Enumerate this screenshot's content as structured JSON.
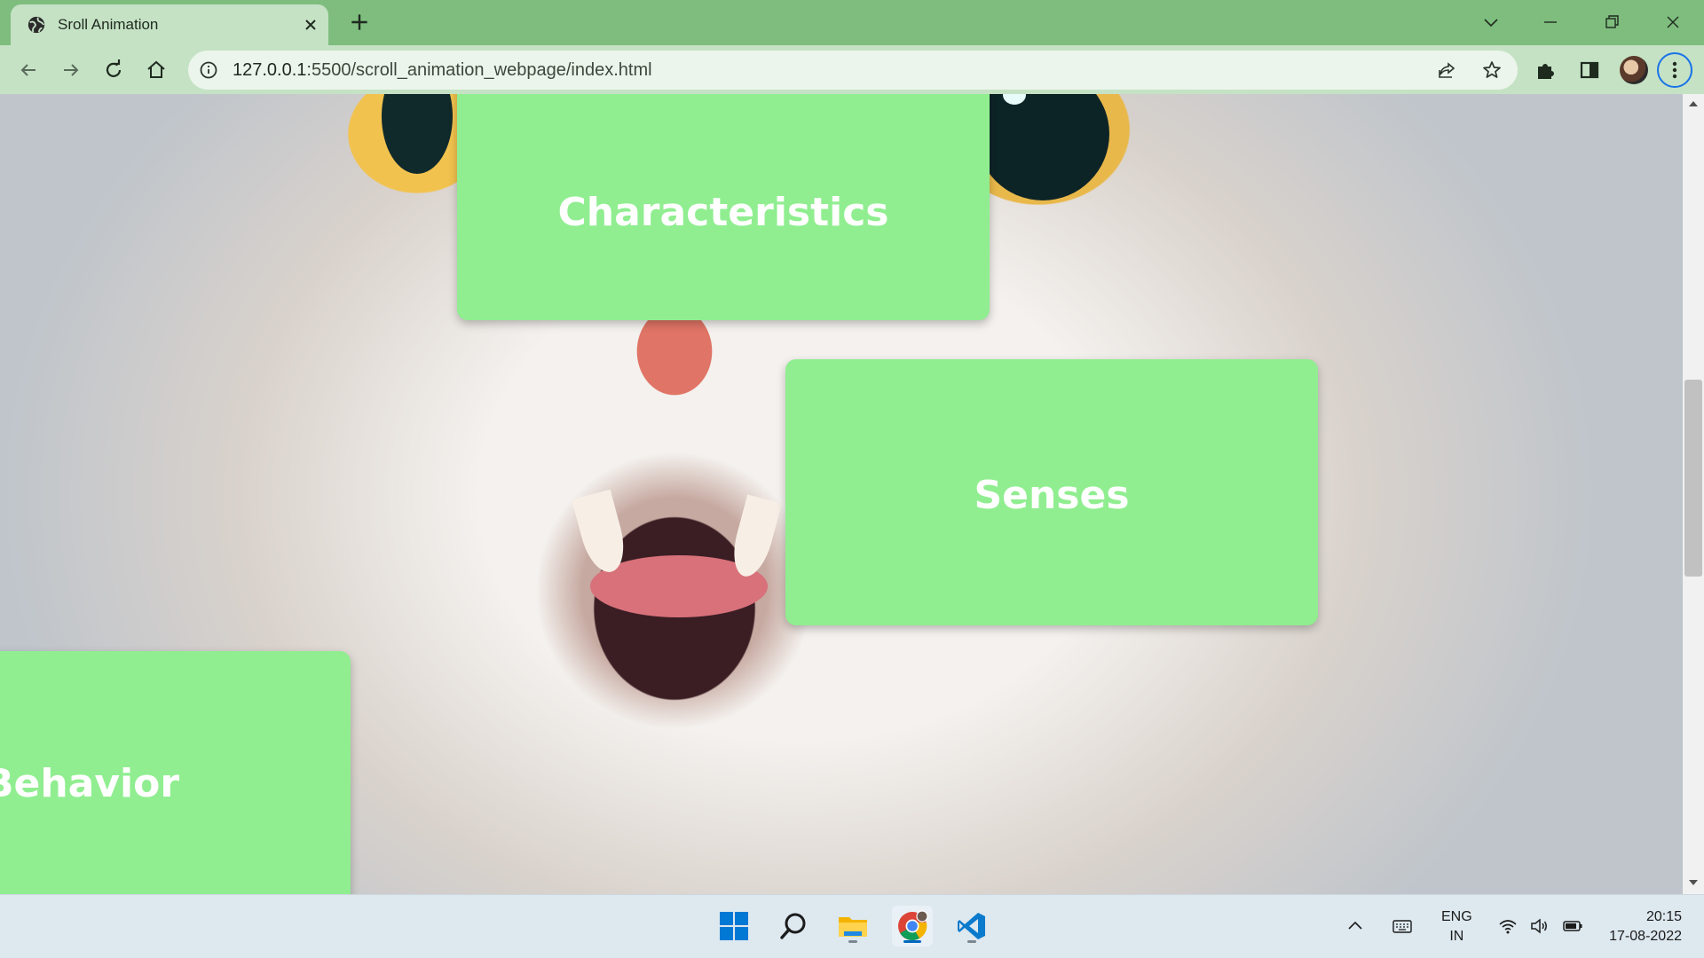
{
  "browser": {
    "tab_title": "Sroll Animation",
    "url_host": "127.0.0.1",
    "url_rest": ":5500/scroll_animation_webpage/index.html"
  },
  "page": {
    "cards": [
      {
        "title": "Characteristics"
      },
      {
        "title": "Senses"
      },
      {
        "title": "Behavior"
      }
    ],
    "scroll_position": 0.36
  },
  "taskbar": {
    "apps": [
      "start-icon",
      "search-icon",
      "file-explorer-icon",
      "chrome-icon",
      "vscode-icon"
    ],
    "language_line1": "ENG",
    "language_line2": "IN",
    "time": "20:15",
    "date": "17-08-2022"
  },
  "colors": {
    "tab_strip": "#7ebd7e",
    "toolbar": "#c5e2c5",
    "card": "#90ee90",
    "accent": "#1a73e8"
  }
}
